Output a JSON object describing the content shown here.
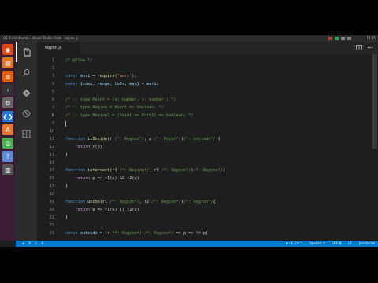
{
  "os_bar": {
    "title": "OS X via Ubuntu · Visual Studio Code · region.js",
    "clock": "11:35"
  },
  "launcher": {
    "items": [
      "ubuntu",
      "files",
      "firefox",
      "terminal",
      "settings",
      "vscode",
      "store",
      "chrome",
      "help",
      "trash"
    ]
  },
  "activity_bar": {
    "items": [
      "explorer",
      "search",
      "git",
      "debug",
      "extensions"
    ]
  },
  "tabs": [
    {
      "label": "region.js"
    }
  ],
  "editor": {
    "cursor_line": 8,
    "lines": [
      {
        "num": "1",
        "parts": [
          {
            "t": "/* @flow */",
            "c": "c"
          }
        ]
      },
      {
        "num": "2",
        "parts": []
      },
      {
        "num": "3",
        "parts": [
          {
            "t": "const ",
            "c": "k"
          },
          {
            "t": "mori",
            "c": "v"
          },
          {
            "t": " = ",
            "c": "p"
          },
          {
            "t": "require",
            "c": "f"
          },
          {
            "t": "(",
            "c": "p"
          },
          {
            "t": "'mori'",
            "c": "s"
          },
          {
            "t": ");",
            "c": "p"
          }
        ]
      },
      {
        "num": "4",
        "parts": [
          {
            "t": "const ",
            "c": "k"
          },
          {
            "t": "{comp, range, toJs, map}",
            "c": "v"
          },
          {
            "t": " = ",
            "c": "p"
          },
          {
            "t": "mori",
            "c": "v"
          },
          {
            "t": ";",
            "c": "p"
          }
        ]
      },
      {
        "num": "5",
        "parts": []
      },
      {
        "num": "6",
        "parts": [
          {
            "t": "/* :: type Point = {x: number, y: number}; */",
            "c": "c"
          }
        ]
      },
      {
        "num": "7",
        "parts": [
          {
            "t": "/* :: type Region = Point => boolean; */",
            "c": "c"
          }
        ]
      },
      {
        "num": "8",
        "parts": [
          {
            "t": "/* :: type Region2 = (Point => Point) => boolean; */",
            "c": "c"
          }
        ]
      },
      {
        "num": "9",
        "parts": []
      },
      {
        "num": "10",
        "parts": []
      },
      {
        "num": "11",
        "parts": [
          {
            "t": "function ",
            "c": "k"
          },
          {
            "t": "isInside",
            "c": "f"
          },
          {
            "t": "(r ",
            "c": "p"
          },
          {
            "t": "/*: Region*/",
            "c": "c"
          },
          {
            "t": ", p ",
            "c": "p"
          },
          {
            "t": "/*: Point*/",
            "c": "c"
          },
          {
            "t": ")",
            "c": "p"
          },
          {
            "t": "/*: boolean*/",
            "c": "c"
          },
          {
            "t": " {",
            "c": "p"
          }
        ]
      },
      {
        "num": "12",
        "parts": [
          {
            "t": "    ",
            "c": "p"
          },
          {
            "t": "return ",
            "c": "kw"
          },
          {
            "t": "r(p)",
            "c": "p"
          }
        ]
      },
      {
        "num": "13",
        "parts": [
          {
            "t": "}",
            "c": "p"
          }
        ]
      },
      {
        "num": "14",
        "parts": []
      },
      {
        "num": "15",
        "parts": [
          {
            "t": "function ",
            "c": "k"
          },
          {
            "t": "intersect",
            "c": "f"
          },
          {
            "t": "(r1 ",
            "c": "p"
          },
          {
            "t": "/*: Region*/",
            "c": "c"
          },
          {
            "t": ", r2 ",
            "c": "p"
          },
          {
            "t": "/*: Region*/",
            "c": "c"
          },
          {
            "t": ")",
            "c": "p"
          },
          {
            "t": "/*: Region*/",
            "c": "c"
          },
          {
            "t": "{",
            "c": "p"
          }
        ]
      },
      {
        "num": "16",
        "parts": [
          {
            "t": "    ",
            "c": "p"
          },
          {
            "t": "return ",
            "c": "kw"
          },
          {
            "t": "p => r1(p) && r2(p)",
            "c": "p"
          }
        ]
      },
      {
        "num": "17",
        "parts": [
          {
            "t": "}",
            "c": "p"
          }
        ]
      },
      {
        "num": "18",
        "parts": []
      },
      {
        "num": "19",
        "parts": [
          {
            "t": "function ",
            "c": "k"
          },
          {
            "t": "union",
            "c": "f"
          },
          {
            "t": "(r1 ",
            "c": "p"
          },
          {
            "t": "/*: Region*/",
            "c": "c"
          },
          {
            "t": ", r2 ",
            "c": "p"
          },
          {
            "t": "/*: Region*/",
            "c": "c"
          },
          {
            "t": ")",
            "c": "p"
          },
          {
            "t": "/*: Region*/",
            "c": "c"
          },
          {
            "t": "{",
            "c": "p"
          }
        ]
      },
      {
        "num": "20",
        "parts": [
          {
            "t": "    ",
            "c": "p"
          },
          {
            "t": "return ",
            "c": "kw"
          },
          {
            "t": "p => r1(p) || r2(p)",
            "c": "p"
          }
        ]
      },
      {
        "num": "21",
        "parts": [
          {
            "t": "}",
            "c": "p"
          }
        ]
      },
      {
        "num": "22",
        "parts": []
      },
      {
        "num": "23",
        "parts": [
          {
            "t": "const ",
            "c": "k"
          },
          {
            "t": "outside",
            "c": "v"
          },
          {
            "t": " = (r ",
            "c": "p"
          },
          {
            "t": "/*: Region*/",
            "c": "c"
          },
          {
            "t": ")",
            "c": "p"
          },
          {
            "t": "/*: Region*/",
            "c": "c"
          },
          {
            "t": " => p => !r(p)",
            "c": "p"
          }
        ]
      }
    ]
  },
  "status_bar": {
    "left": [
      "0",
      "0"
    ],
    "right": [
      "Ln 8, Col 1",
      "Spaces: 4",
      "UTF-8",
      "LF",
      "JavaScript"
    ]
  },
  "colors": {
    "status": "#007acc",
    "editor_bg": "#1e1e1e",
    "launcher": "#3a1c33"
  }
}
